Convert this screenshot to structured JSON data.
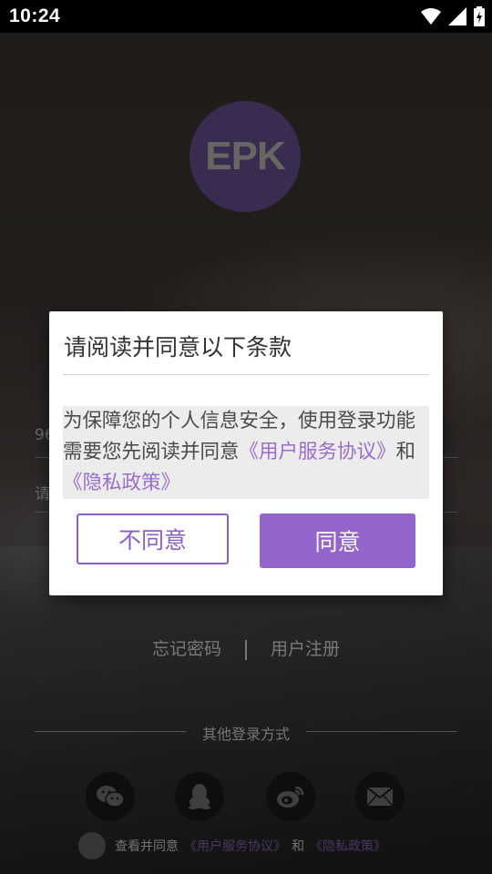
{
  "status_bar": {
    "time": "10:24",
    "icons": [
      "wifi-icon",
      "signal-icon",
      "battery-icon"
    ]
  },
  "logo": {
    "text": "EPK"
  },
  "login_form": {
    "phone_placeholder": "96",
    "password_placeholder": "请"
  },
  "links": {
    "forgot_password": "忘记密码",
    "register": "用户注册"
  },
  "other_login": {
    "label": "其他登录方式",
    "methods": [
      "wechat-icon",
      "qq-icon",
      "weibo-icon",
      "mail-icon"
    ]
  },
  "agreement_row": {
    "prefix": "查看并同意",
    "terms": "《用户服务协议》",
    "and": "和",
    "privacy": "《隐私政策》"
  },
  "dialog": {
    "title": "请阅读并同意以下条款",
    "body_text": "为保障您的个人信息安全，使用登录功能需要您先阅读并同意",
    "terms_link": "《用户服务协议》",
    "and": "和",
    "privacy_link": "《隐私政策》",
    "disagree_label": "不同意",
    "agree_label": "同意"
  },
  "colors": {
    "accent": "#9466cc",
    "accent_text": "#8b5fc7",
    "link": "#9a6dcc",
    "logo_bg": "#4e3a6b"
  }
}
